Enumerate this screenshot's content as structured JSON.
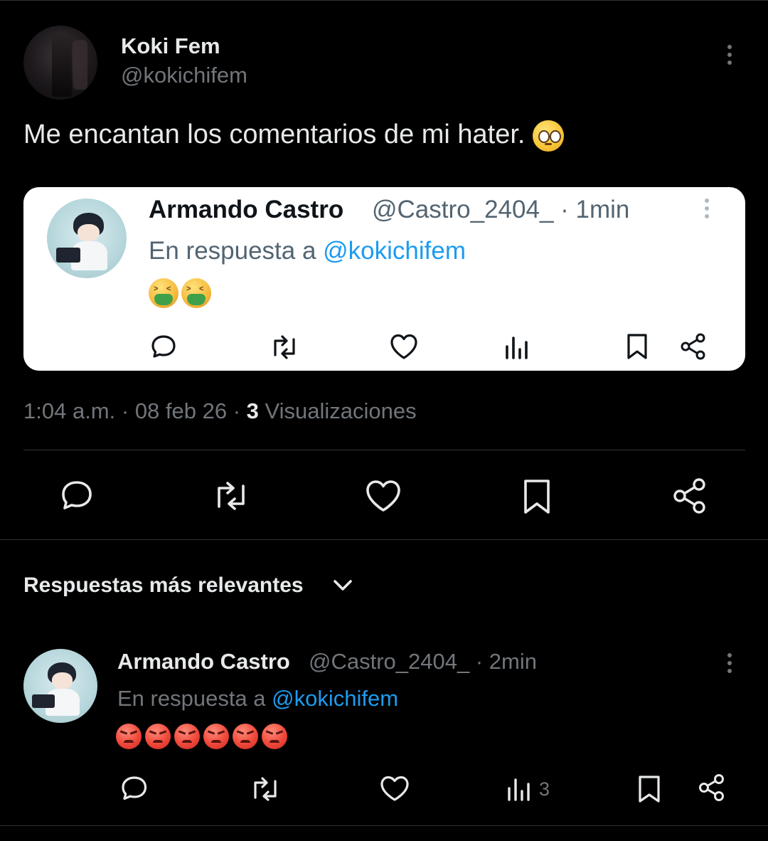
{
  "post": {
    "author_name": "Koki Fem",
    "author_handle": "@kokichifem",
    "text": "Me encantan los comentarios de mi hater.",
    "emoji": "pleading-face",
    "timestamp": "1:04 a.m.",
    "sep1": " · ",
    "date": "08 feb 26",
    "sep2": " · ",
    "views_count": "3",
    "views_label": " Visualizaciones"
  },
  "quoted": {
    "name": "Armando Castro",
    "handle_time": "@Castro_2404_ · 1min",
    "reply_prefix": "En respuesta a ",
    "reply_mention": "@kokichifem",
    "emojis": [
      "nauseated-face",
      "nauseated-face"
    ]
  },
  "replies_header": {
    "label": "Respuestas más relevantes"
  },
  "reply": {
    "name": "Armando Castro",
    "handle_time": "@Castro_2404_ · 2min",
    "reply_prefix": "En respuesta a ",
    "reply_mention": "@kokichifem",
    "emojis": [
      "angry-face",
      "angry-face",
      "angry-face",
      "angry-face",
      "angry-face",
      "angry-face"
    ],
    "views_count": "3"
  },
  "colors": {
    "background": "#000000",
    "text": "#e7e9ea",
    "muted": "#71767b",
    "accent": "#1d9bf0",
    "divider": "#2f3336"
  }
}
